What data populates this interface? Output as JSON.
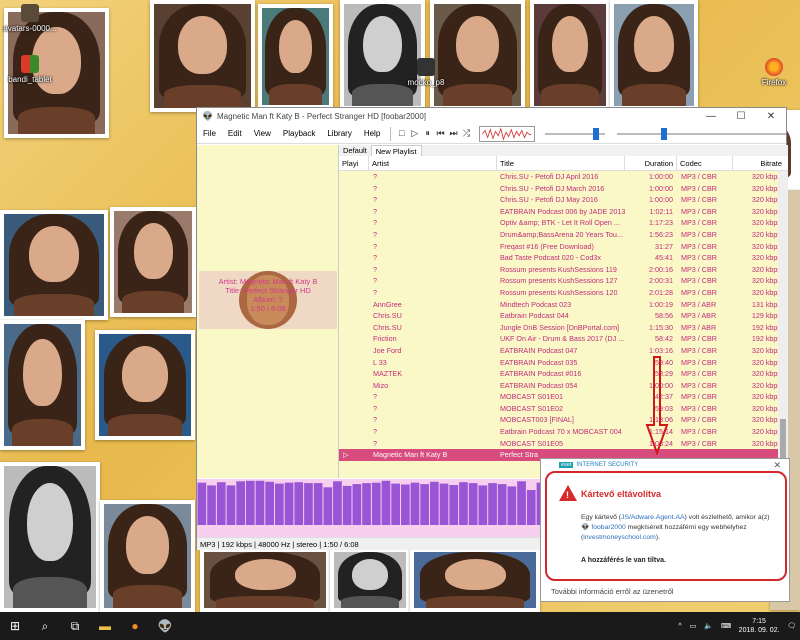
{
  "desktop": {
    "icons": [
      {
        "label": "avatars-0000..."
      },
      {
        "label": "bandi_tablet"
      },
      {
        "label": "mocko_p8"
      },
      {
        "label": "Firefox"
      }
    ]
  },
  "window": {
    "title": "Magnetic Man ft Katy B - Perfect Stranger HD  [foobar2000]",
    "menu": [
      "File",
      "Edit",
      "View",
      "Playback",
      "Library",
      "Help"
    ],
    "controls": {
      "minimize": "—",
      "maximize": "☐",
      "close": "✕"
    },
    "volume_level": 0.9,
    "seek_position": 0.27
  },
  "left_panel": {
    "artist_line": "Artist: Magnetic Man ft Katy B",
    "title_line": "Title: Perfect Stranger HD",
    "album_line": "Album: ?",
    "time_line": "1:50 / 6:08"
  },
  "tabs": [
    {
      "label": "Default"
    },
    {
      "label": "New Playlist"
    }
  ],
  "playlist": {
    "columns": {
      "playi": "Playi",
      "artist": "Artist",
      "title": "Title",
      "duration": "Duration",
      "codec": "Codec",
      "bitrate": "Bitrate"
    },
    "rows": [
      {
        "playi": "",
        "artist": "?",
        "title": "Chris.SU - Petofi DJ April 2016",
        "duration": "1:00:00",
        "codec": "MP3 / CBR",
        "bitrate": "320 kbps"
      },
      {
        "playi": "",
        "artist": "?",
        "title": "Chris.SU - Petofi DJ March 2016",
        "duration": "1:00:00",
        "codec": "MP3 / CBR",
        "bitrate": "320 kbps"
      },
      {
        "playi": "",
        "artist": "?",
        "title": "Chris.SU - Petofi DJ May 2016",
        "duration": "1:00:00",
        "codec": "MP3 / CBR",
        "bitrate": "320 kbps"
      },
      {
        "playi": "",
        "artist": "?",
        "title": "EATBRAIN Podcast 006 by JADE 2013",
        "duration": "1:02:11",
        "codec": "MP3 / CBR",
        "bitrate": "320 kbps"
      },
      {
        "playi": "",
        "artist": "?",
        "title": "Optiv &amp; BTK - Let It Roll Open ...",
        "duration": "1:17:23",
        "codec": "MP3 / CBR",
        "bitrate": "320 kbps"
      },
      {
        "playi": "",
        "artist": "?",
        "title": "Drum&amp;BassArena 20 Years Tou...",
        "duration": "1:56:23",
        "codec": "MP3 / CBR",
        "bitrate": "320 kbps"
      },
      {
        "playi": "",
        "artist": "?",
        "title": "Freqast #16 (Free Download)",
        "duration": "31:27",
        "codec": "MP3 / CBR",
        "bitrate": "320 kbps"
      },
      {
        "playi": "",
        "artist": "?",
        "title": "Bad Taste Podcast 020 - Cod3x",
        "duration": "45:41",
        "codec": "MP3 / CBR",
        "bitrate": "320 kbps"
      },
      {
        "playi": "",
        "artist": "?",
        "title": "Rossum presents KushSessions 119",
        "duration": "2:00:16",
        "codec": "MP3 / CBR",
        "bitrate": "320 kbps"
      },
      {
        "playi": "",
        "artist": "?",
        "title": "Rossum presents KushSessions 127",
        "duration": "2:00:31",
        "codec": "MP3 / CBR",
        "bitrate": "320 kbps"
      },
      {
        "playi": "",
        "artist": "?",
        "title": "Rossum presents KushSessions 120",
        "duration": "2:01:28",
        "codec": "MP3 / CBR",
        "bitrate": "320 kbps"
      },
      {
        "playi": "",
        "artist": "AnnGree",
        "title": "Mindtech Podcast 023",
        "duration": "1:00:19",
        "codec": "MP3 / ABR",
        "bitrate": "131 kbps"
      },
      {
        "playi": "",
        "artist": "Chris.SU",
        "title": "Eatbrain Podcast 044",
        "duration": "58:56",
        "codec": "MP3 / ABR",
        "bitrate": "129 kbps"
      },
      {
        "playi": "",
        "artist": "Chris.SU",
        "title": "Jungle DnB Session [DnBPortal.com]",
        "duration": "1:15:30",
        "codec": "MP3 / ABR",
        "bitrate": "192 kbps"
      },
      {
        "playi": "",
        "artist": "Friction",
        "title": "UKF On Air - Drum & Bass 2017 (DJ ...",
        "duration": "58:42",
        "codec": "MP3 / CBR",
        "bitrate": "192 kbps"
      },
      {
        "playi": "",
        "artist": "Joe Ford",
        "title": "EATBRAIN Podcast 047",
        "duration": "1:03:16",
        "codec": "MP3 / CBR",
        "bitrate": "320 kbps"
      },
      {
        "playi": "",
        "artist": "L 33",
        "title": "EATBRAIN Podcast 035",
        "duration": "59:40",
        "codec": "MP3 / CBR",
        "bitrate": "320 kbps"
      },
      {
        "playi": "",
        "artist": "MAZTEK",
        "title": "EATBRAIN Podcast #016",
        "duration": "58:29",
        "codec": "MP3 / CBR",
        "bitrate": "320 kbps"
      },
      {
        "playi": "",
        "artist": "Mizo",
        "title": "EATBRAIN Podcast 054",
        "duration": "1:00:00",
        "codec": "MP3 / CBR",
        "bitrate": "320 kbps"
      },
      {
        "playi": "",
        "artist": "?",
        "title": "MOBCAST S01E01",
        "duration": "42:37",
        "codec": "MP3 / CBR",
        "bitrate": "320 kbps"
      },
      {
        "playi": "",
        "artist": "?",
        "title": "MOBCAST S01E02",
        "duration": "59:03",
        "codec": "MP3 / CBR",
        "bitrate": "320 kbps"
      },
      {
        "playi": "",
        "artist": "?",
        "title": "MOBCAST003 [FINAL]",
        "duration": "1:13:06",
        "codec": "MP3 / CBR",
        "bitrate": "320 kbps"
      },
      {
        "playi": "",
        "artist": "?",
        "title": "Eatbrain Podcast 70 x MOBCAST 004",
        "duration": "1:15:14",
        "codec": "MP3 / CBR",
        "bitrate": "320 kbps"
      },
      {
        "playi": "",
        "artist": "?",
        "title": "MOBCAST S01E05",
        "duration": "1:08:24",
        "codec": "MP3 / CBR",
        "bitrate": "320 kbps"
      },
      {
        "playi": "▷",
        "artist": "Magnetic Man ft Katy B",
        "title": "Perfect Stra",
        "duration": "",
        "codec": "",
        "bitrate": "",
        "playing": true
      }
    ]
  },
  "spectrum": {
    "levels": [
      0.92,
      0.86,
      0.93,
      0.86,
      0.95,
      0.96,
      0.96,
      0.94,
      0.9,
      0.92,
      0.93,
      0.91,
      0.91,
      0.82,
      0.95,
      0.85,
      0.89,
      0.91,
      0.92,
      0.96,
      0.9,
      0.88,
      0.92,
      0.89,
      0.94,
      0.9,
      0.87,
      0.93,
      0.91,
      0.86,
      0.91,
      0.89,
      0.84,
      0.95,
      0.76,
      0.92,
      0.84,
      0.91,
      0.85,
      0.89,
      0.82,
      0.74,
      0.58,
      0.72,
      0.66,
      0.46,
      0.44,
      0.38,
      0.58,
      0.51,
      0.49,
      0.4,
      0.28,
      0.46,
      0.28,
      0.24,
      0.17,
      0.21,
      0.14,
      0.08,
      0.07
    ],
    "colors": {
      "bar": "#8a3fd1",
      "bg": "#f6d0ee",
      "label": "#b0306a"
    }
  },
  "statusbar": {
    "text": "MP3 | 192 kbps | 48000 Hz | stereo | 1:50 / 6:08"
  },
  "eset": {
    "brand": "INTERNET SECURITY",
    "logo": "eset",
    "headline": "Kártevő eltávolítva",
    "message_1": "Egy kártevő (",
    "threat": "JS/Adware.Agent.AA",
    "message_2": ") volt észlelhető, amikor a(z) ",
    "app": "foobar2000",
    "message_3": " megkísérelt hozzáférni egy webhelyhez (",
    "site": "investmoneyschool.com",
    "message_4": ").",
    "blocked": "A hozzáférés le van tiltva.",
    "more": "További információ erről az üzenetről"
  },
  "taskbar": {
    "time": "7:15",
    "date": "2018. 09. 02."
  },
  "colors": {
    "accent_pink": "#c12c7a",
    "playing_row": "#d84b7d",
    "eset_red": "#d62b2b",
    "seek_blue": "#1e6fd0"
  }
}
